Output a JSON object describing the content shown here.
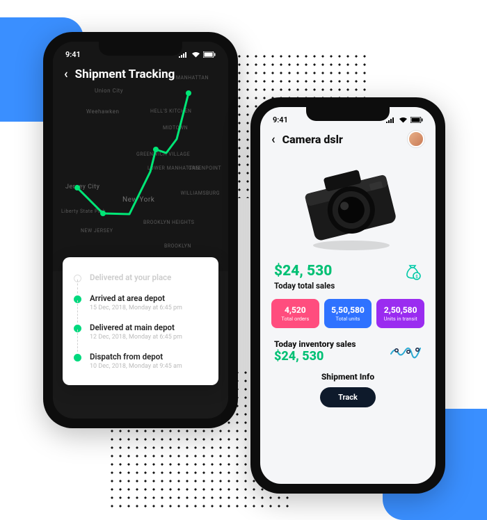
{
  "status": {
    "time": "9:41"
  },
  "phone_left": {
    "title": "Shipment Tracking",
    "map_labels": {
      "manhattan": "MANHATTAN",
      "union_city": "Union City",
      "weehawken": "Weehawken",
      "hells_kitchen": "HELL'S KITCHEN",
      "midtown": "MIDTOWN",
      "greenwich": "GREENWICH VILLAGE",
      "lower_manhattan": "LOWER MANHATTAN",
      "greenpoint": "GREENPOINT",
      "jersey_city": "Jersey City",
      "new_york": "New York",
      "williamsburg": "WILLIAMSBURG",
      "liberty": "Liberty State Park",
      "new_jersey": "NEW JERSEY",
      "brooklyn_heights": "BROOKLYN HEIGHTS",
      "brooklyn": "BROOKLYN"
    },
    "steps": [
      {
        "title": "Delivered at your place",
        "sub": ""
      },
      {
        "title": "Arrived at area depot",
        "sub": "15 Dec, 2018, Monday at 6:45 pm"
      },
      {
        "title": "Delivered at main depot",
        "sub": "12 Dec, 2018, Monday at 6:45 pm"
      },
      {
        "title": "Dispatch from depot",
        "sub": "10 Dec, 2018, Monday at 9:45 am"
      }
    ]
  },
  "phone_right": {
    "title": "Camera dslr",
    "sales_amount": "$24, 530",
    "sales_label": "Today total sales",
    "stats": [
      {
        "num": "4,520",
        "lbl": "Total orders"
      },
      {
        "num": "5,50,580",
        "lbl": "Total units"
      },
      {
        "num": "2,50,580",
        "lbl": "Units in transit"
      }
    ],
    "inventory_title": "Today inventory sales",
    "inventory_amount": "$24, 530",
    "shipment_title": "Shipment Info",
    "track_label": "Track"
  }
}
